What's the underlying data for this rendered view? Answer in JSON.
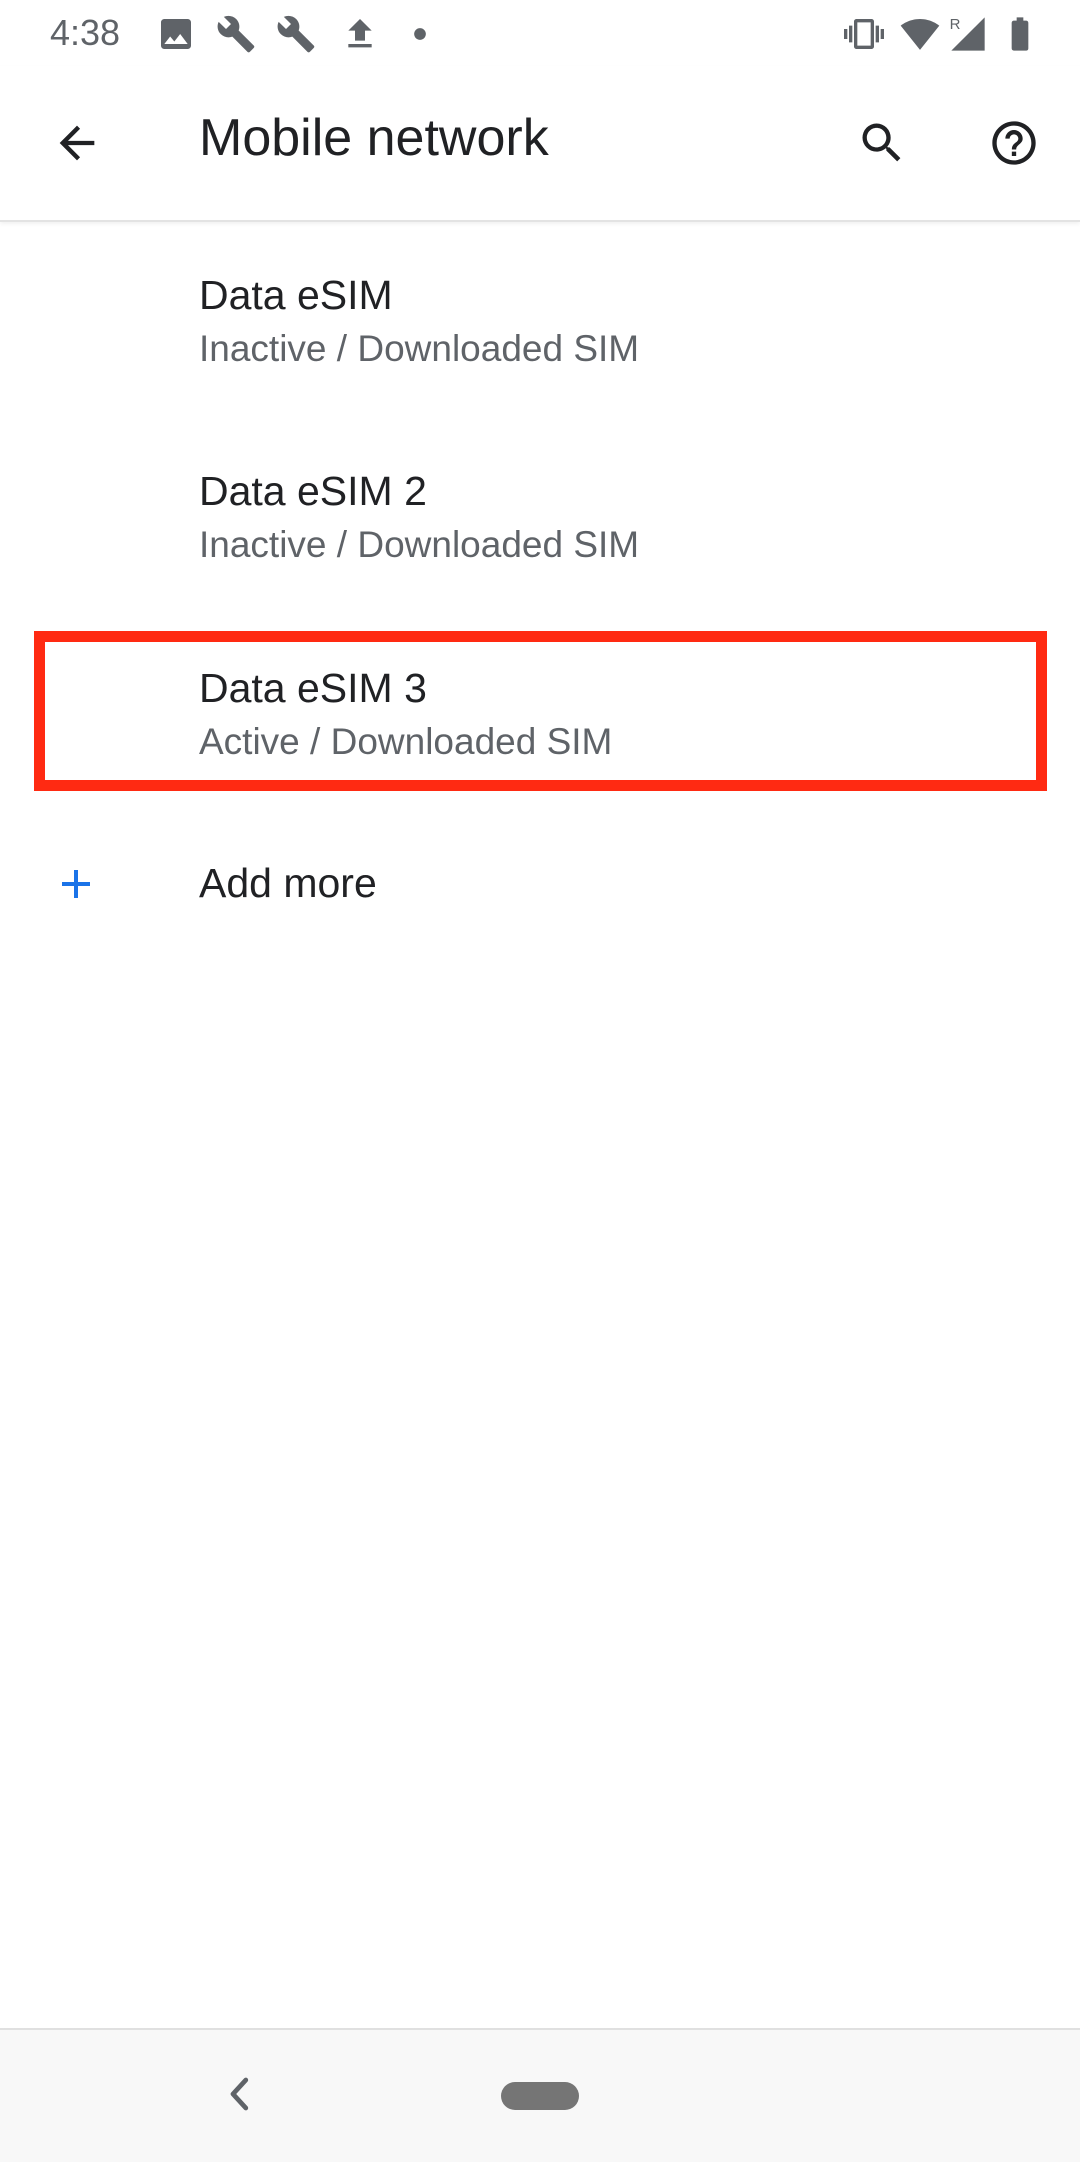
{
  "status_bar": {
    "time": "4:38",
    "left_icons": [
      "image-icon",
      "wrench-icon",
      "wrench-icon",
      "upload-icon",
      "dot-icon"
    ],
    "right_icons": [
      "vibrate-icon",
      "wifi-icon",
      "signal-roaming-icon",
      "battery-icon"
    ],
    "roaming_indicator": "R"
  },
  "app_bar": {
    "title": "Mobile network",
    "back_icon": "arrow-back-icon",
    "search_icon": "search-icon",
    "help_icon": "help-icon"
  },
  "sim_list": [
    {
      "title": "Data eSIM",
      "summary": "Inactive / Downloaded SIM"
    },
    {
      "title": "Data eSIM 2",
      "summary": "Inactive / Downloaded SIM"
    },
    {
      "title": "Data eSIM 3",
      "summary": "Active / Downloaded SIM"
    }
  ],
  "add_more": {
    "label": "Add more",
    "icon": "plus-icon"
  },
  "nav_bar": {
    "back_icon": "nav-back-icon",
    "home_icon": "home-pill-icon"
  },
  "colors": {
    "text_primary": "#202124",
    "text_secondary": "#5f6368",
    "accent": "#1a73e8",
    "highlight": "#ff2a12"
  }
}
